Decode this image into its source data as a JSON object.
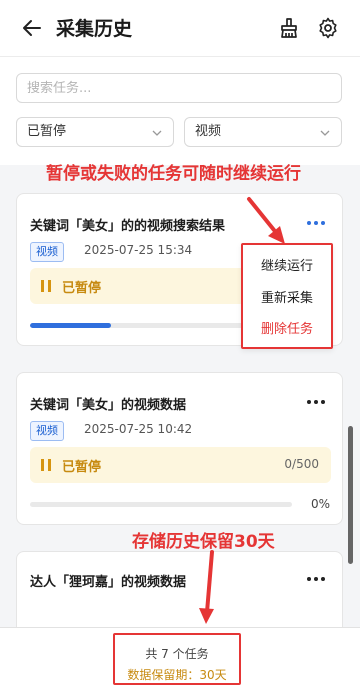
{
  "header": {
    "title": "采集历史",
    "back_icon": "arrow-left-icon",
    "clean_icon": "broom-icon",
    "settings_icon": "gear-icon"
  },
  "filters": {
    "search_placeholder": "搜索任务...",
    "status_select": "已暂停",
    "type_select": "视频"
  },
  "annotations": {
    "top": "暂停或失败的任务可随时继续运行",
    "bottom": "存储历史保留30天"
  },
  "tasks": [
    {
      "title": "关键词「美女」的的视频搜索结果",
      "tag": "视频",
      "time": "2025-07-25 15:34",
      "status": "已暂停",
      "progress": 0.37
    },
    {
      "title": "关键词「美女」的视频数据",
      "tag": "视频",
      "time": "2025-07-25 10:42",
      "status": "已暂停",
      "count": "0/500",
      "progress": 0,
      "percent": "0%"
    },
    {
      "title": "达人「狸珂嘉」的视频数据"
    }
  ],
  "menu": {
    "items": [
      "继续运行",
      "重新采集",
      "删除任务"
    ]
  },
  "footer": {
    "count": "共 7 个任务",
    "retention": "数据保留期：30天"
  },
  "colors": {
    "accent": "#2f6fdd",
    "annotation": "#e53535",
    "paused": "#c78a10",
    "paused_bg": "#fdf6de"
  }
}
